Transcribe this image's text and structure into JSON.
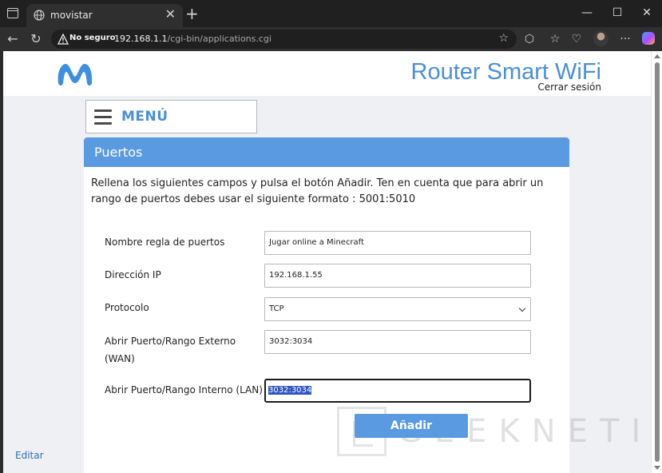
{
  "browser": {
    "tab_title": "movistar",
    "security_label": "No seguro",
    "url_host": "192.168.1.1",
    "url_path": "/cgi-bin/applications.cgi",
    "new_tab_glyph": "+",
    "close_tab_glyph": "✕",
    "icons": [
      "sidebar-toggle-icon",
      "globe-icon",
      "back-icon",
      "reload-icon",
      "warning-icon",
      "star-icon",
      "extensions-icon",
      "favorites-icon",
      "health-icon",
      "profile-avatar",
      "more-icon",
      "copilot-icon",
      "minimize-icon",
      "maximize-icon",
      "close-icon"
    ]
  },
  "header": {
    "brand": "movistar",
    "title": "Router Smart WiFi",
    "logout_label": "Cerrar sesión",
    "brand_color": "#4a8fd9"
  },
  "menu": {
    "label": "MENÚ"
  },
  "panel": {
    "title": "Puertos",
    "intro": "Rellena los siguientes campos y pulsa el botón Añadir. Ten en cuenta que para abrir un rango de puertos debes usar el siguiente formato : 5001:5010",
    "header_color": "#5a9ae0"
  },
  "form": {
    "rule_name": {
      "label": "Nombre regla de puertos",
      "value": "Jugar online a Minecraft"
    },
    "ip_address": {
      "label": "Dirección IP",
      "value": "192.168.1.55"
    },
    "protocol": {
      "label": "Protocolo",
      "value": "TCP"
    },
    "external_range": {
      "label_line1": "Abrir Puerto/Rango Externo",
      "label_line2": "(WAN)",
      "value": "3032:3034"
    },
    "internal_range": {
      "label": "Abrir Puerto/Rango Interno (LAN)",
      "value": "3032:3034"
    }
  },
  "actions": {
    "add_label": "Añadir",
    "edit_label": "Editar"
  },
  "watermark": {
    "text": "GEEKNETIC"
  }
}
